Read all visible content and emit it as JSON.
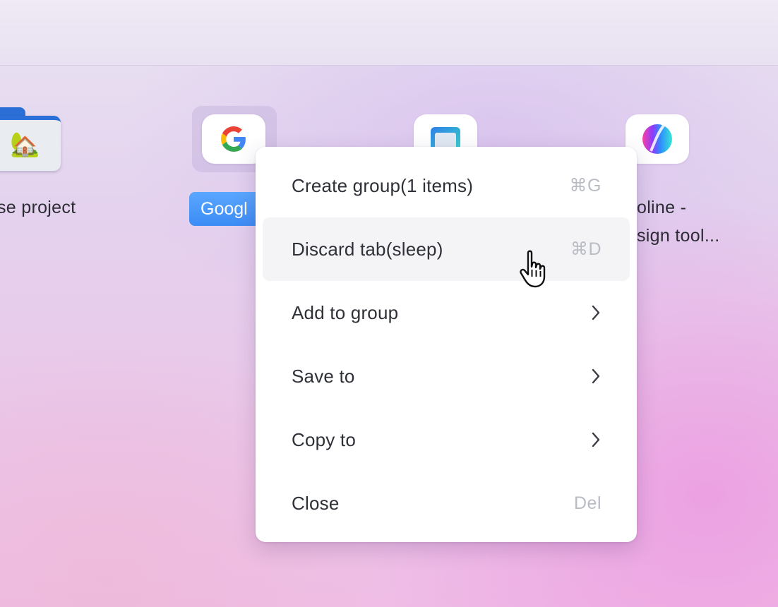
{
  "tiles": [
    {
      "label": "se project",
      "icon": "folder-house-icon"
    },
    {
      "label": "Googl",
      "icon": "google-icon",
      "selected": true
    },
    {
      "label": "",
      "icon": "app-window-icon"
    },
    {
      "label_line1": "oline -",
      "label_line2": "sign tool...",
      "icon": "color-orb-icon"
    }
  ],
  "context_menu": {
    "items": [
      {
        "label": "Create group(1 items)",
        "shortcut": "⌘G"
      },
      {
        "label": "Discard tab(sleep)",
        "shortcut": "⌘D",
        "hovered": true
      },
      {
        "label": "Add to group",
        "submenu": true
      },
      {
        "label": "Save to",
        "submenu": true
      },
      {
        "label": "Copy to",
        "submenu": true
      },
      {
        "label": "Close",
        "shortcut": "Del"
      }
    ]
  },
  "colors": {
    "selection_blue": "#3b8cf5",
    "menu_hover": "#f4f4f6",
    "shortcut_gray": "#b9bcc4",
    "folder_blue": "#2c6fd8"
  }
}
